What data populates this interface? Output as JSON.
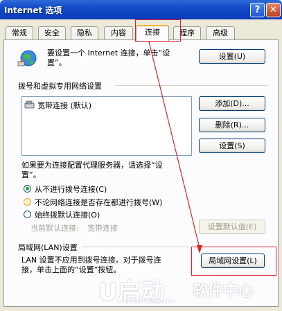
{
  "window": {
    "title": "Internet 选项",
    "help_glyph": "?",
    "close_glyph": "✕"
  },
  "tabs": [
    {
      "label": "常规"
    },
    {
      "label": "安全"
    },
    {
      "label": "隐私"
    },
    {
      "label": "内容"
    },
    {
      "label": "连接",
      "active": true
    },
    {
      "label": "程序"
    },
    {
      "label": "高级"
    }
  ],
  "setup": {
    "text_line1": "要设置一个 Internet 连接，单击“设",
    "text_line2": "置”。",
    "button": "设置(U)",
    "icon": "globe-network-icon"
  },
  "dialup": {
    "group_label": "拨号和虚拟专用网络设置",
    "connections": [
      {
        "label": "宽带连接 (默认)",
        "icon": "broadband-connection-icon"
      }
    ],
    "add_button": "添加(D)...",
    "remove_button": "删除(R)...",
    "settings_button": "设置(S)",
    "proxy_hint_line1": "如果要为连接配置代理服务器，请选择“设",
    "proxy_hint_line2": "置”。",
    "radios": [
      {
        "label": "从不进行拨号连接(C)",
        "checked": true
      },
      {
        "label": "不论网络连接是否存在都进行拨号(W)",
        "checked": false
      },
      {
        "label": "始终拨默认连接(O)",
        "checked": false
      }
    ],
    "current_default_label": "当前默认连接:",
    "current_default_value": "宽带连接",
    "set_default_button": "设置默认值(E)"
  },
  "lan": {
    "group_label": "局域网(LAN)设置",
    "desc_line1": "LAN 设置不应用到拨号连接。对于拨号连",
    "desc_line2": "接，单击上面的“设置”按钮。",
    "button": "局域网设置(L)"
  },
  "watermark": {
    "logo": "U启动",
    "text": "软件中心",
    "url": "WWW.UQIDONG.COM"
  },
  "colors": {
    "annotation": "#e21f26",
    "titlebar": "#1148c8",
    "tab_highlight": "#f0b030"
  }
}
